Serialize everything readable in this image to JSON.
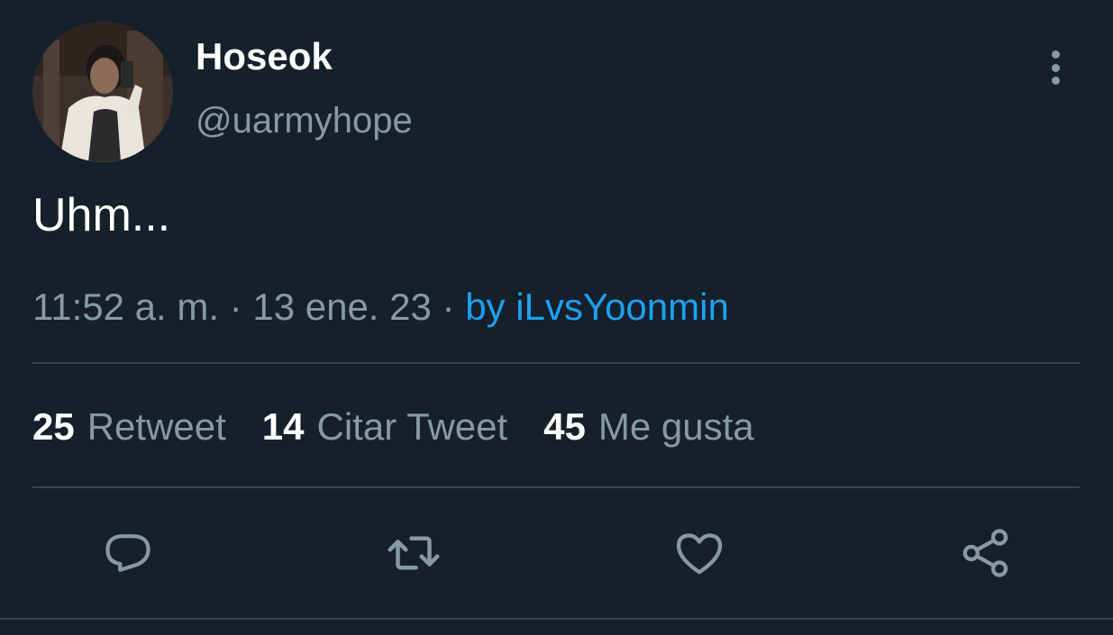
{
  "user": {
    "display_name": "Hoseok",
    "handle": "@uarmyhope"
  },
  "tweet": {
    "text": "Uhm...",
    "time": "11:52 a. m.",
    "separator1": " · ",
    "date": "13 ene. 23",
    "separator2": " · ",
    "source": "by iLvsYoonmin"
  },
  "stats": {
    "retweets": {
      "count": "25",
      "label": "Retweet"
    },
    "quotes": {
      "count": "14",
      "label": "Citar Tweet"
    },
    "likes": {
      "count": "45",
      "label": "Me gusta"
    }
  },
  "icons": {
    "reply": "speech-bubble-icon",
    "retweet": "retweet-arrows-icon",
    "like": "heart-icon",
    "share": "share-nodes-icon",
    "more": "vertical-ellipsis-icon"
  },
  "colors": {
    "background": "#15202b",
    "primary_text": "#ffffff",
    "secondary_text": "#8899a6",
    "accent": "#1da1f2",
    "divider": "#38444d"
  }
}
